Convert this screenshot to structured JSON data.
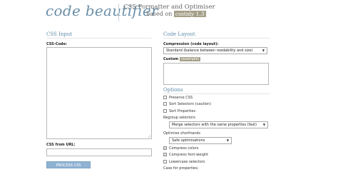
{
  "header": {
    "logo": "code beautifier",
    "tagline": "CSS Formatter and Optimiser",
    "based_on_prefix": "based on",
    "based_on_badge": "csstidy 1.3"
  },
  "left": {
    "heading": "CSS Input",
    "css_code_label": "CSS-Code:",
    "css_from_url_label": "CSS from URL:",
    "process_button": "PROCESS CSS"
  },
  "right": {
    "heading": "Code Layout",
    "compression_label": "Compression (code layout):",
    "compression_value": "Standard (balance between readability and size)",
    "custom_label": "Custom",
    "custom_badge": "(example)",
    "options_heading": "Options",
    "preserve_css": "Preserve CSS",
    "sort_selectors": "Sort Selectors (caution)",
    "sort_properties": "Sort Properties",
    "regroup_label": "Regroup selectors",
    "regroup_value": "Merge selectors with the same properties (fast)",
    "optimise_label": "Optimise shorthands",
    "optimise_value": "Safe optimisations",
    "compress_colors": "Compress colors",
    "compress_font_weight": "Compress font-weight",
    "lowercase_selectors": "Lowercase selectors",
    "case_label": "Case for properties:"
  },
  "checkbox_states": {
    "preserve_css": false,
    "sort_selectors": false,
    "sort_properties": false,
    "compress_colors": true,
    "compress_font_weight": true,
    "lowercase_selectors": false
  }
}
